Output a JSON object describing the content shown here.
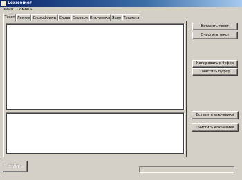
{
  "window": {
    "title": "Lexicomer"
  },
  "menu": {
    "items": [
      "Файл",
      "Помощь"
    ]
  },
  "tabs": {
    "items": [
      "Текст",
      "Леммы",
      "Словоформы",
      "Слова",
      "Словари",
      "Ключевики",
      "Ядро",
      "Тошнота"
    ],
    "active": "Текст"
  },
  "main_text": {
    "value": ""
  },
  "keywords_text": {
    "value": ""
  },
  "buttons": {
    "paste_text": "Вставить текст",
    "clear_text": "Очистить текст",
    "copy_buffer": "Копировать в буфер",
    "clear_buffer": "Очистить буфер",
    "paste_keywords": "Вставить ключевики",
    "clear_keywords": "Очистить ключевики",
    "start": "СТАРТ >"
  },
  "progress": {
    "value": 0
  },
  "colors": {
    "face": "#d4d0c8",
    "titlebar_start": "#0a246a",
    "titlebar_end": "#a6caf0"
  }
}
